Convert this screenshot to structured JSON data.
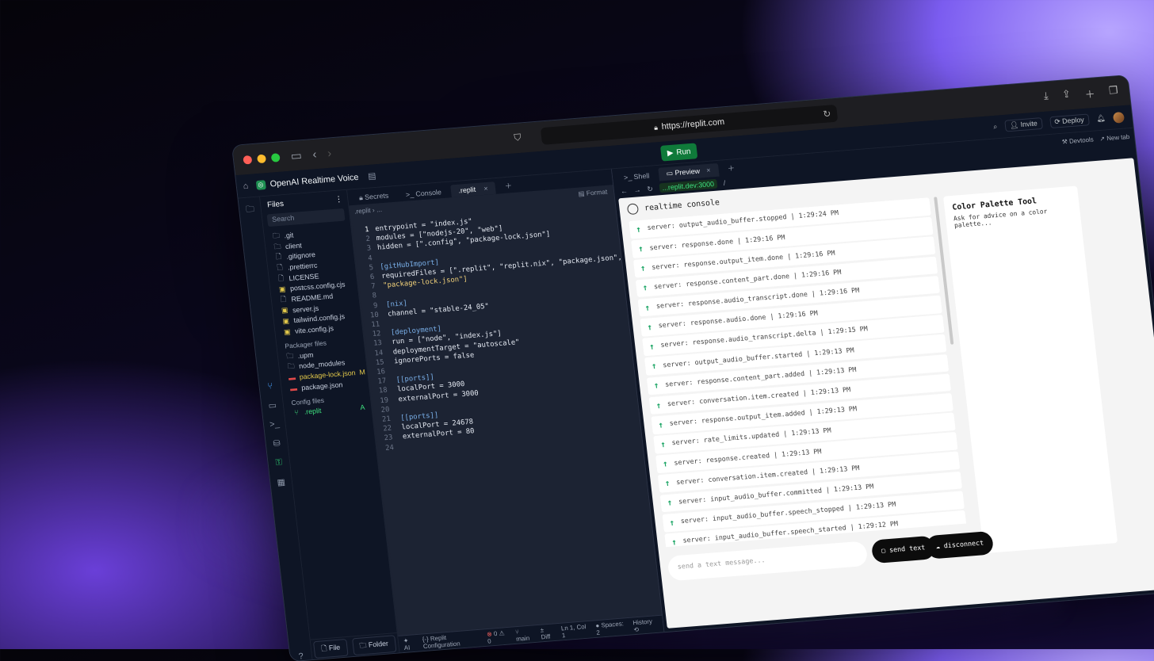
{
  "browser": {
    "url": "https://replit.com"
  },
  "project": {
    "name": "OpenAI Realtime Voice",
    "run_label": "Run"
  },
  "topbar": {
    "invite": "Invite",
    "deploy": "Deploy"
  },
  "files": {
    "title": "Files",
    "search_placeholder": "Search",
    "items": [
      ".git",
      "client",
      ".gitignore",
      ".prettierrc",
      "LICENSE",
      "postcss.config.cjs",
      "README.md",
      "server.js",
      "tailwind.config.js",
      "vite.config.js"
    ],
    "packager_label": "Packager files",
    "packager_items": [
      ".upm",
      "node_modules",
      "package-lock.json",
      "package.json"
    ],
    "package_lock_badge": "M",
    "config_label": "Config files",
    "config_items": [
      ".replit"
    ],
    "config_badge": "A",
    "new_file": "File",
    "new_folder": "Folder"
  },
  "editor": {
    "tabs": [
      "Secrets",
      "Console",
      ".replit"
    ],
    "breadcrumb": ".replit  ›  ...",
    "format": "Format",
    "lines": [
      "entrypoint = \"index.js\"",
      "modules = [\"nodejs-20\", \"web\"]",
      "hidden = [\".config\", \"package-lock.json\"]",
      "",
      "[gitHubImport]",
      "requiredFiles = [\".replit\", \"replit.nix\", \"package.json\",",
      "\"package-lock.json\"]",
      "",
      "[nix]",
      "channel = \"stable-24_05\"",
      "",
      "[deployment]",
      "run = [\"node\", \"index.js\"]",
      "deploymentTarget = \"autoscale\"",
      "ignorePorts = false",
      "",
      "[[ports]]",
      "localPort = 3000",
      "externalPort = 3000",
      "",
      "[[ports]]",
      "localPort = 24678",
      "externalPort = 80",
      ""
    ],
    "status": {
      "ai": "AI",
      "config": "Replit Configuration",
      "errors": "0",
      "warnings": "0",
      "branch": "main",
      "diff": "Diff",
      "cursor": "Ln 1, Col 1",
      "spaces": "Spaces: 2",
      "history": "History"
    }
  },
  "preview": {
    "tabs": [
      "Shell",
      "Preview"
    ],
    "url": "...replit.dev:3000",
    "path": "/",
    "devtools": "Devtools",
    "newtab": "New tab",
    "app_title": "realtime console",
    "events": [
      {
        "text": "server: output_audio_buffer.stopped | 1:29:24 PM"
      },
      {
        "text": "server: response.done | 1:29:16 PM"
      },
      {
        "text": "server: response.output_item.done | 1:29:16 PM"
      },
      {
        "text": "server: response.content_part.done | 1:29:16 PM"
      },
      {
        "text": "server: response.audio_transcript.done | 1:29:16 PM"
      },
      {
        "text": "server: response.audio.done | 1:29:16 PM"
      },
      {
        "text": "server: response.audio_transcript.delta | 1:29:15 PM"
      },
      {
        "text": "server: output_audio_buffer.started | 1:29:13 PM"
      },
      {
        "text": "server: response.content_part.added | 1:29:13 PM"
      },
      {
        "text": "server: conversation.item.created | 1:29:13 PM"
      },
      {
        "text": "server: response.output_item.added | 1:29:13 PM"
      },
      {
        "text": "server: rate_limits.updated | 1:29:13 PM"
      },
      {
        "text": "server: response.created | 1:29:13 PM"
      },
      {
        "text": "server: conversation.item.created | 1:29:13 PM"
      },
      {
        "text": "server: input_audio_buffer.committed | 1:29:13 PM"
      },
      {
        "text": "server: input_audio_buffer.speech_stopped | 1:29:13 PM"
      },
      {
        "text": "server: input_audio_buffer.speech_started | 1:29:12 PM"
      }
    ],
    "tool_title": "Color Palette Tool",
    "tool_desc": "Ask for advice on a color palette...",
    "input_placeholder": "send a text message...",
    "send_label": "send text",
    "disconnect_label": "disconnect"
  }
}
